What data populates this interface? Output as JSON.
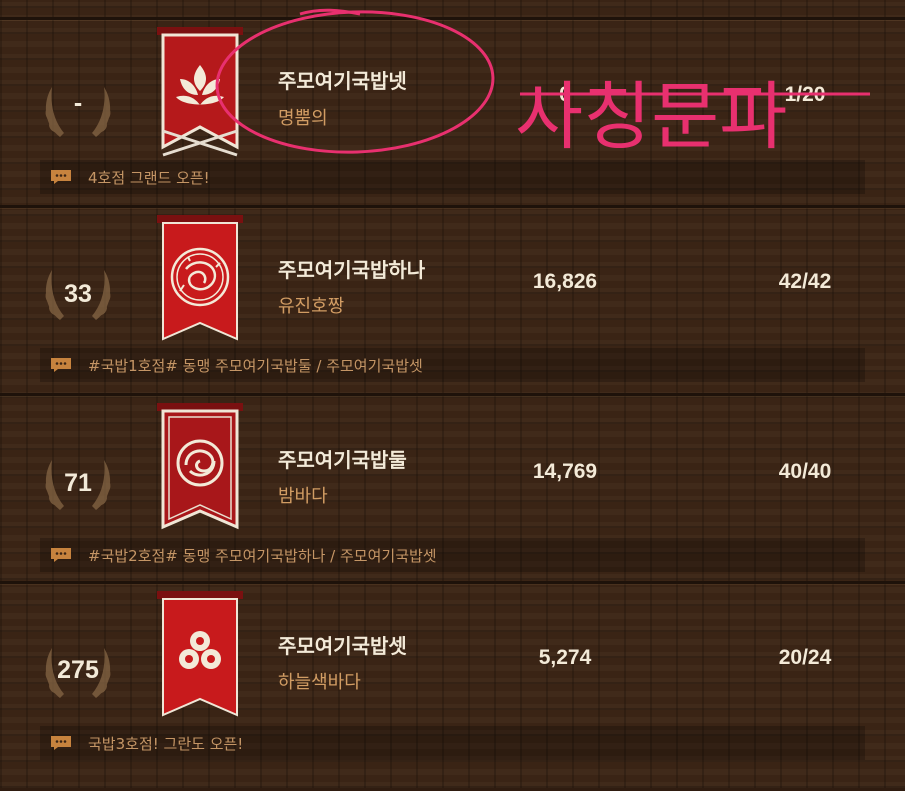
{
  "guilds": [
    {
      "rank": "-",
      "name": "주모여기국밥넷",
      "leader": "명뿜의",
      "score": "0",
      "members": "1/20",
      "notice": "4호점 그랜드 오픈!",
      "emblem": "lotus-emblem-icon"
    },
    {
      "rank": "33",
      "name": "주모여기국밥하나",
      "leader": "유진호짱",
      "score": "16,826",
      "members": "42/42",
      "notice": "#국밥1호점#  동맹 주모여기국밥둘 / 주모여기국밥셋",
      "emblem": "dragon-emblem-icon"
    },
    {
      "rank": "71",
      "name": "주모여기국밥둘",
      "leader": "밤바다",
      "score": "14,769",
      "members": "40/40",
      "notice": "#국밥2호점# 동맹 주모여기국밥하나 / 주모여기국밥셋",
      "emblem": "swirl-emblem-icon"
    },
    {
      "rank": "275",
      "name": "주모여기국밥셋",
      "leader": "하늘색바다",
      "score": "5,274",
      "members": "20/24",
      "notice": "국밥3호점! 그란도 오픈!",
      "emblem": "triple-circle-emblem-icon"
    }
  ],
  "annotation": {
    "handwritten_text": "사칭문파",
    "color": "#e8306f"
  },
  "colors": {
    "banner_red": "#b5191b",
    "text_light": "#f3ead8",
    "text_gold": "#d19c63",
    "notice_text": "#c49565"
  }
}
